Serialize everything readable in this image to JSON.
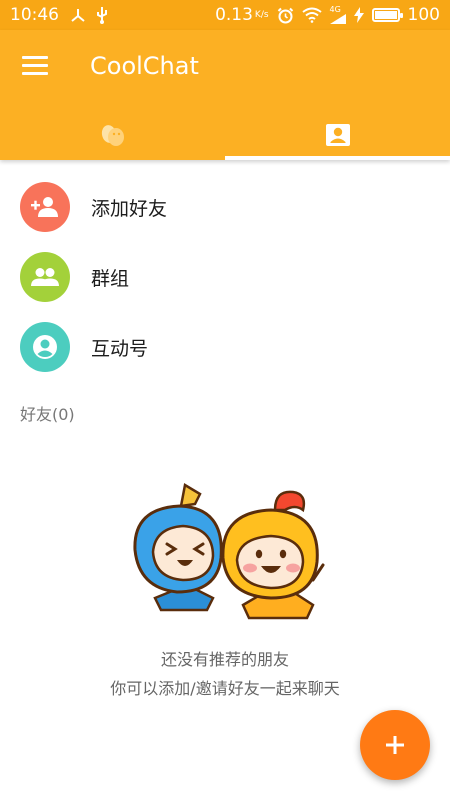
{
  "status_bar": {
    "time": "10:46",
    "network_speed": "0.13",
    "network_unit": "K/s",
    "signal_label": "4G",
    "battery_percent": "100",
    "battery_level": 1.0
  },
  "app_bar": {
    "title": "CoolChat",
    "menu_icon": "hamburger-menu-icon",
    "color": "#fcb023"
  },
  "tabs": [
    {
      "icon": "chat-bird-icon",
      "selected": false
    },
    {
      "icon": "contacts-icon",
      "selected": true
    }
  ],
  "list": {
    "items": [
      {
        "label": "添加好友",
        "icon": "add-person-icon",
        "color": "#f8735a"
      },
      {
        "label": "群组",
        "icon": "group-icon",
        "color": "#a3d13a"
      },
      {
        "label": "互动号",
        "icon": "account-circle-icon",
        "color": "#4ccdbf"
      }
    ]
  },
  "friends_section": {
    "header": "好友(0)"
  },
  "empty_state": {
    "line1": "还没有推荐的朋友",
    "line2": "你可以添加/邀请好友一起来聊天",
    "illustration": "two-happy-characters-illustration"
  },
  "fab": {
    "icon": "plus-icon",
    "color": "#ff7a14"
  }
}
